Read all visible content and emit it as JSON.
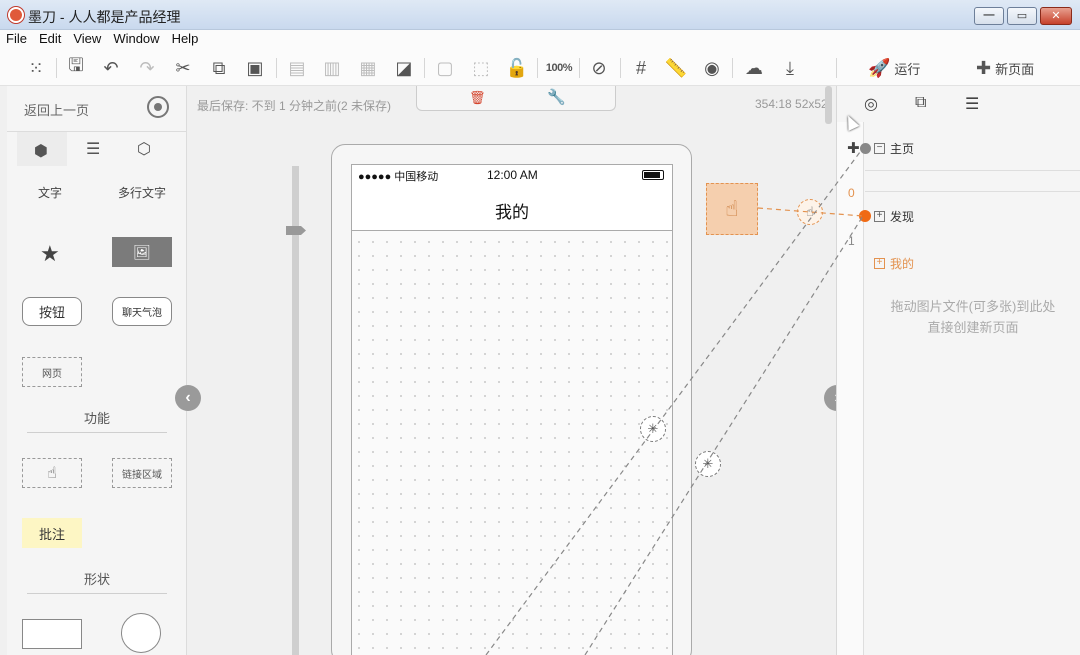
{
  "window": {
    "title": "墨刀 - 人人都是产品经理"
  },
  "menu": [
    "File",
    "Edit",
    "View",
    "Window",
    "Help"
  ],
  "toolbar": {
    "zoom_label": "100%",
    "run_label": "运行",
    "new_page_label": "新页面"
  },
  "left_panel": {
    "back_label": "返回上一页",
    "text_label": "文字",
    "multiline_label": "多行文字",
    "button_label": "按钮",
    "bubble_label": "聊天气泡",
    "web_label": "网页",
    "function_section": "功能",
    "link_area_label": "链接区域",
    "note_label": "批注",
    "shape_section": "形状"
  },
  "canvas": {
    "save_status": "最后保存: 不到 1 分钟之前(2 未保存)",
    "coords": "354:18 52x52"
  },
  "phone": {
    "carrier": "●●●●● 中国移动",
    "time": "12:00 AM",
    "title": "我的"
  },
  "right_panel": {
    "pages": [
      {
        "label": "主页",
        "box": "−"
      },
      {
        "label": "发现",
        "box": "+"
      },
      {
        "label": "我的",
        "box": "+"
      }
    ],
    "numbers": [
      "0",
      "1"
    ],
    "hint_line1": "拖动图片文件(可多张)到此处",
    "hint_line2": "直接创建新页面"
  },
  "colors": {
    "accent": "#e3924f",
    "link_dot": "#f06a14",
    "panel_bg": "#f5f5f5"
  }
}
